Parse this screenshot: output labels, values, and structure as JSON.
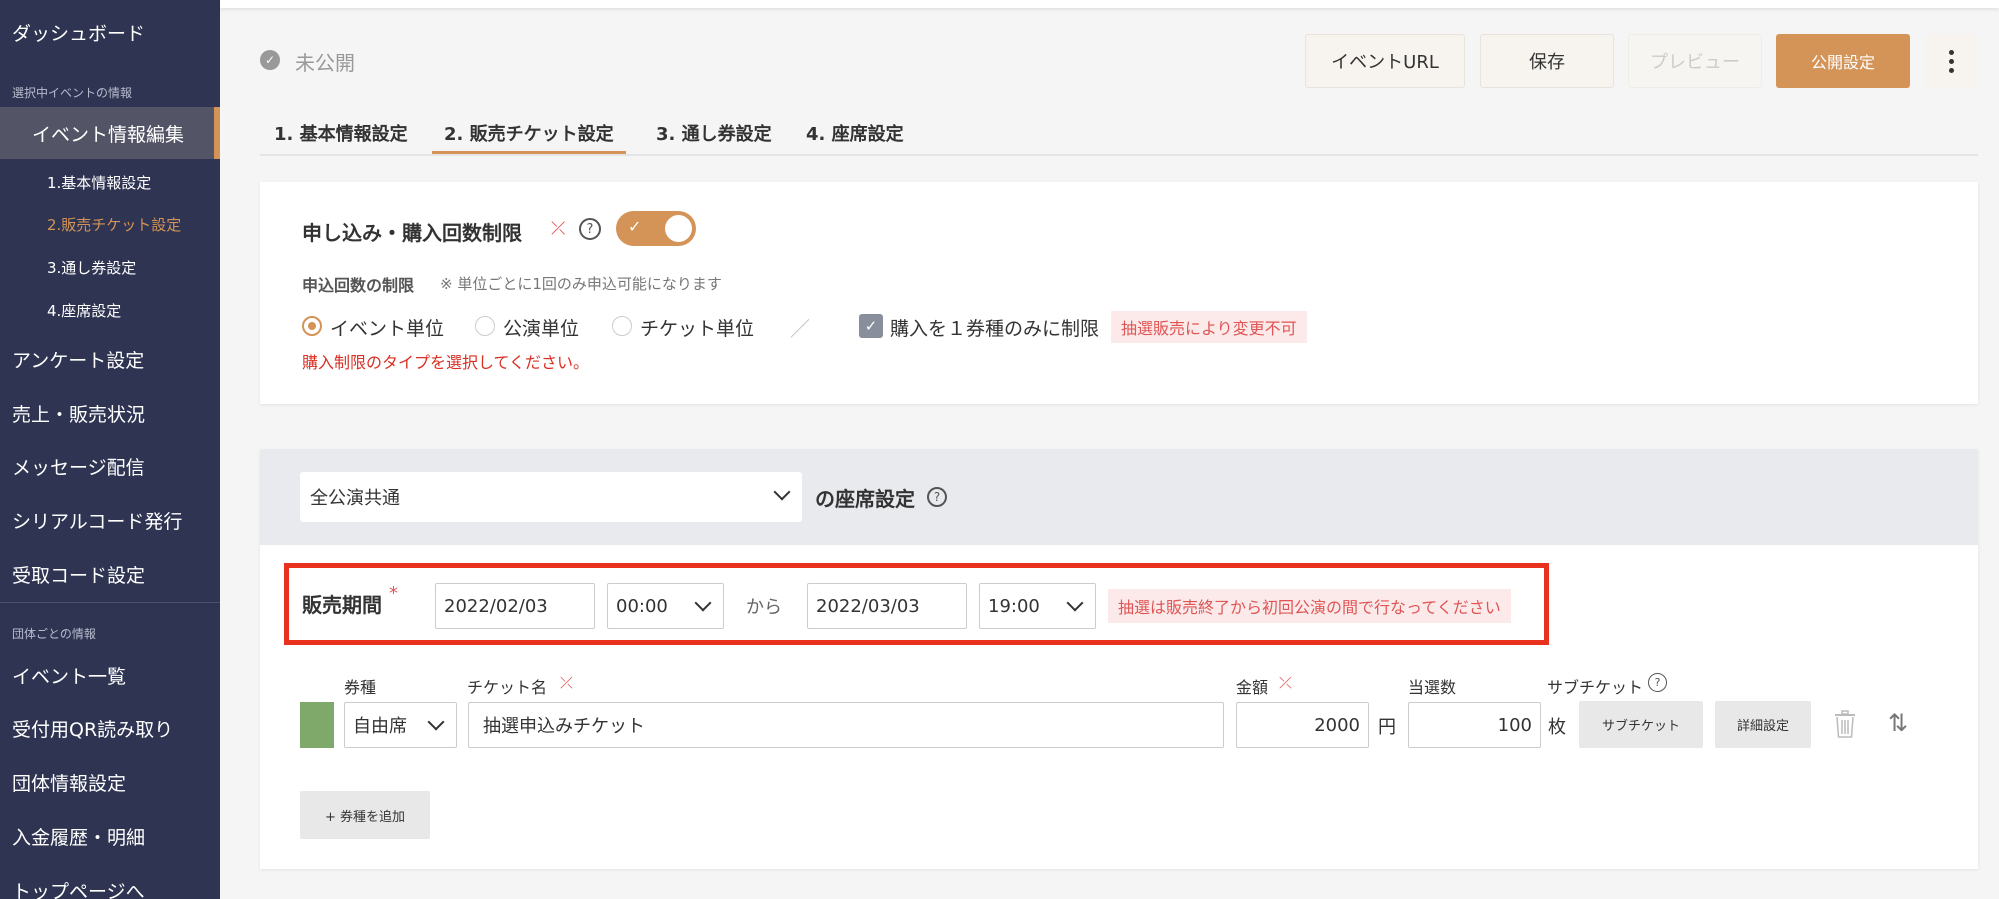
{
  "sidebar": {
    "dashboard": "ダッシュボード",
    "section_selected_event": "選択中イベントの情報",
    "event_edit": "イベント情報編集",
    "sub_items": [
      "1.基本情報設定",
      "2.販売チケット設定",
      "3.通し券設定",
      "4.座席設定"
    ],
    "items_a": [
      "アンケート設定",
      "売上・販売状況",
      "メッセージ配信",
      "シリアルコード発行",
      "受取コード設定"
    ],
    "section_group": "団体ごとの情報",
    "items_b": [
      "イベント一覧",
      "受付用QR読み取り",
      "団体情報設定",
      "入金履歴・明細",
      "トップページへ"
    ]
  },
  "header": {
    "status": "未公開",
    "buttons": {
      "event_url": "イベントURL",
      "save": "保存",
      "preview": "プレビュー",
      "publish": "公開設定"
    }
  },
  "tabs": [
    "1. 基本情報設定",
    "2. 販売チケット設定",
    "3. 通し券設定",
    "4. 座席設定"
  ],
  "limit_card": {
    "title": "申し込み・購入回数制限",
    "help": "?",
    "sub_label": "申込回数の制限",
    "sub_note": "※ 単位ごとに1回のみ申込可能になります",
    "options": [
      "イベント単位",
      "公演単位",
      "チケット単位"
    ],
    "selected_option": "イベント単位",
    "separator": "／",
    "checkbox_label": "購入を１券種のみに制限",
    "checkbox_badge": "抽選販売により変更不可",
    "error": "購入制限のタイプを選択してください。"
  },
  "seat_card": {
    "scope_select": "全公演共通",
    "scope_suffix": "の座席設定",
    "help": "?",
    "period_label": "販売期間",
    "required_mark": "*",
    "start_date": "2022/02/03",
    "start_time": "00:00",
    "from": "から",
    "end_date": "2022/03/03",
    "end_time": "19:00",
    "period_warning": "抽選は販売終了から初回公演の間で行なってください",
    "columns": {
      "type": "券種",
      "name": "チケット名",
      "price": "金額",
      "winners": "当選数",
      "sub_ticket": "サブチケット"
    },
    "ticket": {
      "type": "自由席",
      "name": "抽選申込みチケット",
      "price": "2000",
      "price_unit": "円",
      "winners": "100",
      "winners_unit": "枚",
      "sub_ticket_btn": "サブチケット",
      "detail_btn": "詳細設定",
      "color": "#7fa96a"
    },
    "add_type": "+ 券種を追加"
  },
  "colors": {
    "accent": "#d49357",
    "sidebar": "#2e3451",
    "highlight": "#e8321e",
    "error": "#d93025"
  }
}
